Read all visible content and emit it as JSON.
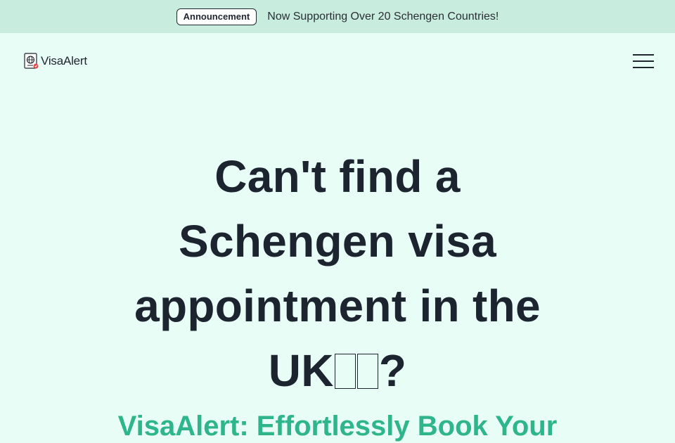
{
  "announcement": {
    "badge": "Announcement",
    "text": "Now Supporting Over 20 Schengen Countries!"
  },
  "nav": {
    "logo_text": "VisaAlert",
    "logo_icon": "passport-globe-icon",
    "menu_icon": "hamburger-menu-icon"
  },
  "hero": {
    "title_line1": "Can't find a",
    "title_line2": "Schengen visa",
    "title_line3": "appointment in the",
    "title_line4": "UK",
    "title_flag": "🇬🇧",
    "title_end": "?",
    "subtitle": "VisaAlert: Effortlessly Book Your"
  },
  "colors": {
    "background": "#e9fdf7",
    "announcement_bar": "#c8ecdd",
    "text_dark": "#1c2430",
    "accent_green": "#2eb58a"
  }
}
